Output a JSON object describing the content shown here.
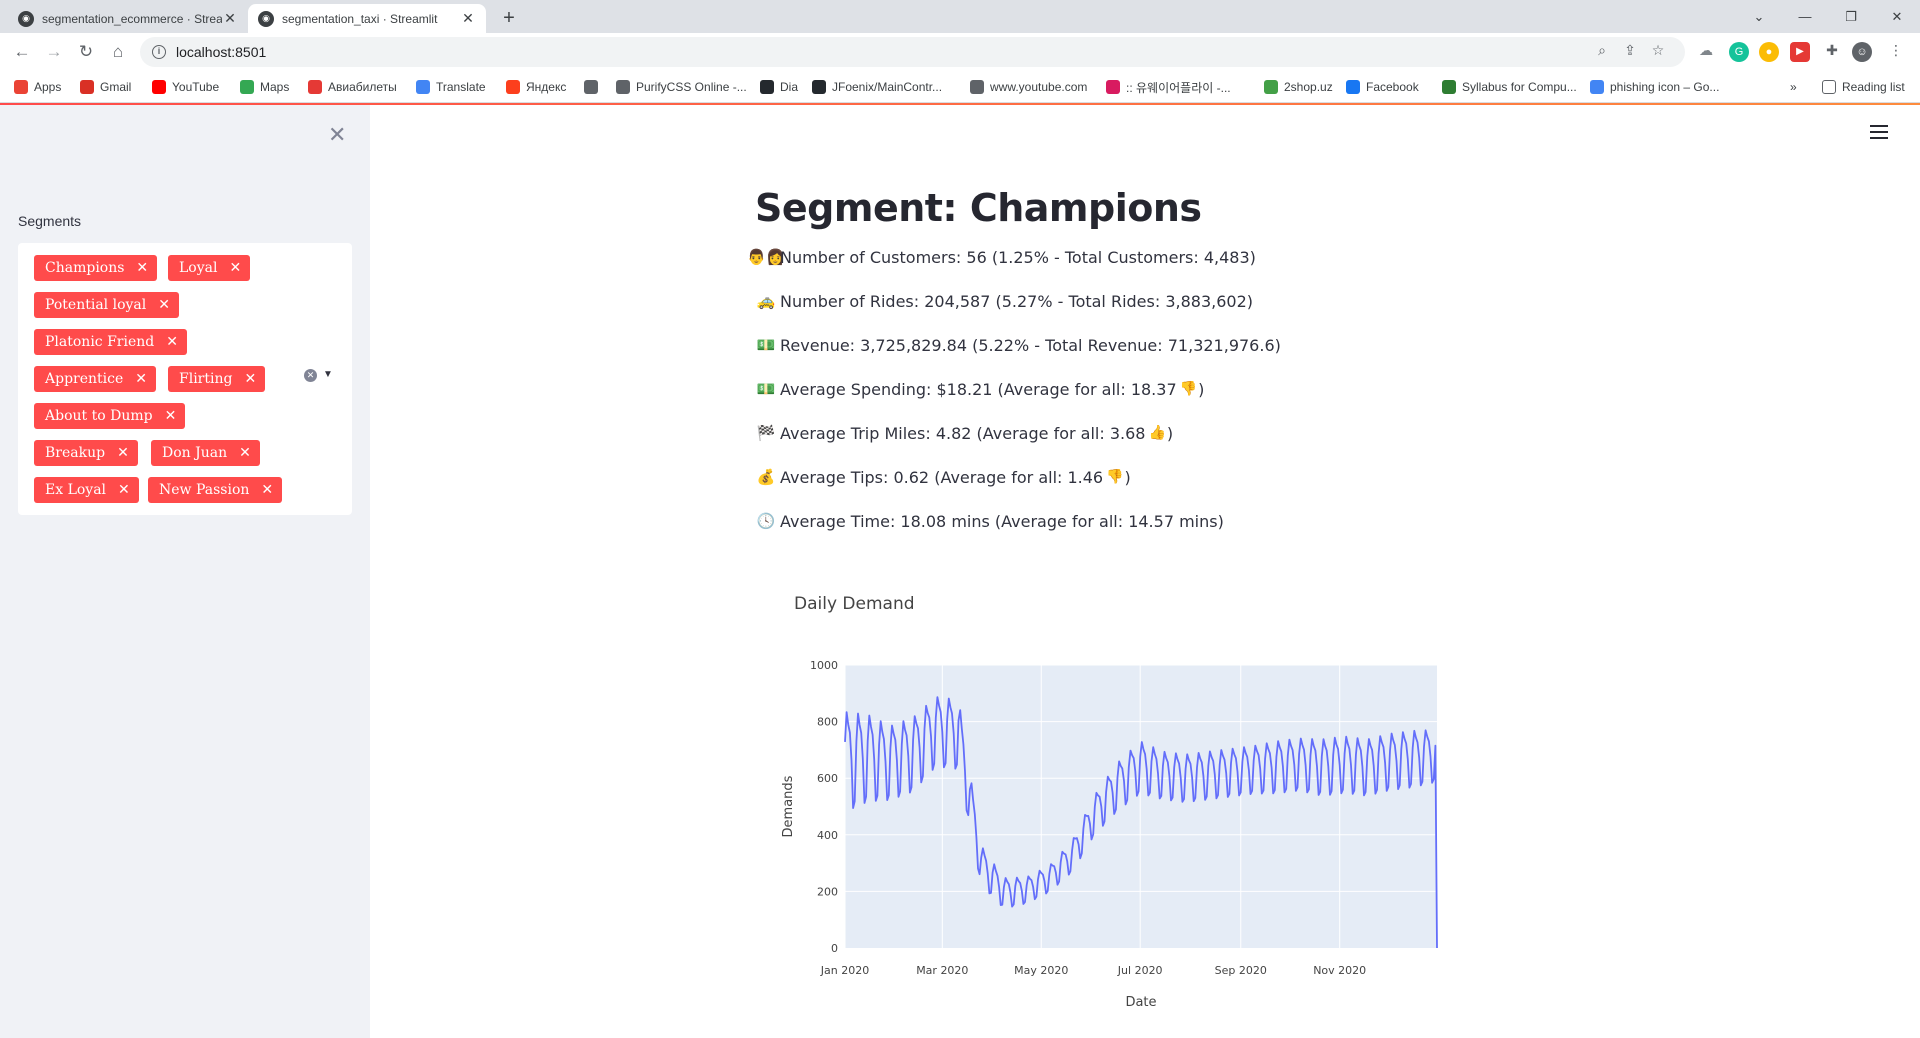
{
  "browser": {
    "tabs": [
      {
        "title": "segmentation_ecommerce · Strea",
        "active": false
      },
      {
        "title": "segmentation_taxi · Streamlit",
        "active": true
      }
    ],
    "url": "localhost:8501",
    "bookmarks": [
      {
        "label": "Apps",
        "color": "#ea4335"
      },
      {
        "label": "Gmail",
        "color": "#d93025"
      },
      {
        "label": "YouTube",
        "color": "#ff0000"
      },
      {
        "label": "Maps",
        "color": "#34a853"
      },
      {
        "label": "Авиабилеты",
        "color": "#e53935"
      },
      {
        "label": "Translate",
        "color": "#4285f4"
      },
      {
        "label": "Яндекс",
        "color": "#fc3f1d"
      },
      {
        "label": "",
        "color": "#5f6368"
      },
      {
        "label": "PurifyCSS Online -...",
        "color": "#5f6368"
      },
      {
        "label": "Dia",
        "color": "#24292e"
      },
      {
        "label": "JFoenix/MainContr...",
        "color": "#24292e"
      },
      {
        "label": "www.youtube.com",
        "color": "#5f6368"
      },
      {
        "label": ":: 유웨이어플라이 -...",
        "color": "#d81b60"
      },
      {
        "label": "2shop.uz",
        "color": "#43a047"
      },
      {
        "label": "Facebook",
        "color": "#1877f2"
      },
      {
        "label": "Syllabus for Compu...",
        "color": "#2e7d32"
      },
      {
        "label": "phishing icon – Go...",
        "color": "#4285f4"
      }
    ],
    "bookmarks_overflow": "»",
    "reading_list": "Reading list"
  },
  "sidebar": {
    "label": "Segments",
    "chips": [
      "Champions",
      "Loyal",
      "Potential loyal",
      "Platonic Friend",
      "Apprentice",
      "Flirting",
      "About to Dump",
      "Breakup",
      "Don Juan",
      "Ex Loyal",
      "New Passion"
    ],
    "chip_color": "#ff4b4b"
  },
  "main": {
    "title": "Segment: Champions",
    "stats": [
      {
        "icon": "people-icon",
        "emoji": "👨‍👩",
        "text": "Number of Customers: 56 (1.25% - Total Customers: 4,483)",
        "tail_emoji": "",
        "tail": ""
      },
      {
        "icon": "taxi-icon",
        "emoji": "🚕",
        "text": "Number of Rides: 204,587 (5.27% - Total Rides: 3,883,602)",
        "tail_emoji": "",
        "tail": ""
      },
      {
        "icon": "money-icon",
        "emoji": "💵",
        "text": "Revenue: 3,725,829.84 (5.22% - Total Revenue: 71,321,976.6)",
        "tail_emoji": "",
        "tail": ""
      },
      {
        "icon": "money-icon",
        "emoji": "💵",
        "text": "Average Spending: $18.21 (Average for all: 18.37",
        "tail_emoji": "👎",
        "tail": ")"
      },
      {
        "icon": "checkered-flag-icon",
        "emoji": "🏁",
        "text": "Average Trip Miles: 4.82 (Average for all: 3.68",
        "tail_emoji": "👍",
        "tail": ")"
      },
      {
        "icon": "money-bag-icon",
        "emoji": "💰",
        "text": "Average Tips: 0.62 (Average for all: 1.46",
        "tail_emoji": "👎",
        "tail": ")"
      },
      {
        "icon": "clock-icon",
        "emoji": "🕓",
        "text": "Average Time: 18.08 mins (Average for all: 14.57 mins)",
        "tail_emoji": "",
        "tail": ""
      }
    ]
  },
  "chart_data": {
    "type": "line",
    "title": "Daily Demand",
    "xlabel": "Date",
    "ylabel": "Demands",
    "x_start": "2020-01-01",
    "x_end": "2020-12-31",
    "xticks": [
      "Jan 2020",
      "Mar 2020",
      "May 2020",
      "Jul 2020",
      "Sep 2020",
      "Nov 2020"
    ],
    "yticks": [
      0,
      200,
      400,
      600,
      800,
      1000
    ],
    "ylim": [
      0,
      1000
    ],
    "grid": true,
    "line_color": "#636efa",
    "background": "#e5ecf6",
    "series": [
      {
        "name": "",
        "x": [
          "2020-01-01",
          "2020-01-15",
          "2020-01-29",
          "2020-02-12",
          "2020-02-26",
          "2020-03-11",
          "2020-03-25",
          "2020-04-08",
          "2020-04-22",
          "2020-05-06",
          "2020-05-20",
          "2020-06-03",
          "2020-06-17",
          "2020-07-01",
          "2020-07-15",
          "2020-07-29",
          "2020-08-12",
          "2020-08-26",
          "2020-09-09",
          "2020-09-23",
          "2020-10-07",
          "2020-10-21",
          "2020-11-04",
          "2020-11-18",
          "2020-12-02",
          "2020-12-16",
          "2020-12-30",
          "2020-12-31"
        ],
        "y": [
          680,
          690,
          670,
          700,
          780,
          770,
          300,
          200,
          210,
          250,
          330,
          480,
          580,
          650,
          620,
          610,
          620,
          630,
          640,
          650,
          660,
          650,
          660,
          650,
          670,
          680,
          690,
          0
        ],
        "amplitude": [
          230,
          200,
          170,
          170,
          160,
          160,
          90,
          70,
          60,
          60,
          70,
          90,
          110,
          120,
          110,
          110,
          110,
          110,
          110,
          120,
          120,
          130,
          130,
          130,
          130,
          130,
          120,
          0
        ]
      }
    ]
  }
}
